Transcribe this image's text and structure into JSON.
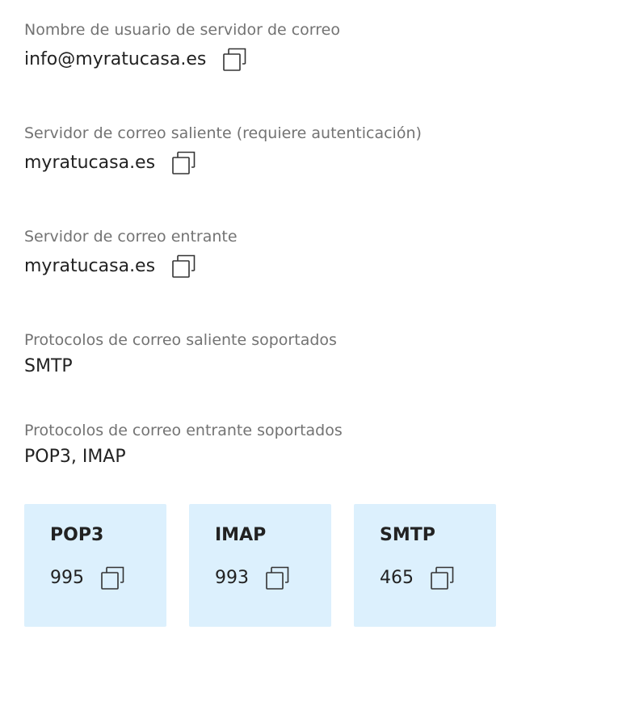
{
  "fields": {
    "username": {
      "label": "Nombre de usuario de servidor de correo",
      "value": "info@myratucasa.es"
    },
    "outgoing_server": {
      "label": "Servidor de correo saliente (requiere autenticación)",
      "value": "myratucasa.es"
    },
    "incoming_server": {
      "label": "Servidor de correo entrante",
      "value": "myratucasa.es"
    },
    "outgoing_protocols": {
      "label": "Protocolos de correo saliente soportados",
      "value": "SMTP"
    },
    "incoming_protocols": {
      "label": "Protocolos de correo entrante soportados",
      "value": "POP3, IMAP"
    }
  },
  "ports": [
    {
      "name": "POP3",
      "port": "995"
    },
    {
      "name": "IMAP",
      "port": "993"
    },
    {
      "name": "SMTP",
      "port": "465"
    }
  ],
  "icons": {
    "copy": "copy-icon"
  },
  "colors": {
    "label_text": "#737373",
    "value_text": "#222222",
    "port_card_bg": "#dcf0fd",
    "icon_stroke": "#333333"
  }
}
